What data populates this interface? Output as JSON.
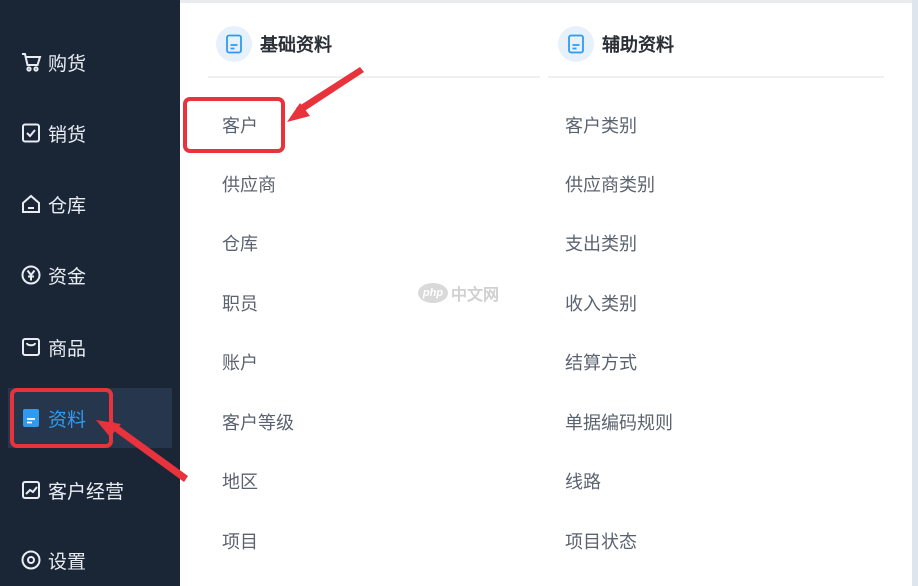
{
  "sidebar": {
    "items": [
      {
        "label": "购货",
        "icon": "cart-icon"
      },
      {
        "label": "销货",
        "icon": "sales-icon"
      },
      {
        "label": "仓库",
        "icon": "warehouse-icon"
      },
      {
        "label": "资金",
        "icon": "yuan-coin-icon"
      },
      {
        "label": "商品",
        "icon": "product-icon"
      },
      {
        "label": "资料",
        "icon": "document-icon",
        "active": true
      },
      {
        "label": "客户经营",
        "icon": "trend-chart-icon"
      },
      {
        "label": "设置",
        "icon": "settings-icon"
      }
    ]
  },
  "panel": {
    "columns": [
      {
        "title": "基础资料",
        "icon": "document-icon",
        "items": [
          "客户",
          "供应商",
          "仓库",
          "职员",
          "账户",
          "客户等级",
          "地区",
          "项目"
        ]
      },
      {
        "title": "辅助资料",
        "icon": "document-icon",
        "items": [
          "客户类别",
          "供应商类别",
          "支出类别",
          "收入类别",
          "结算方式",
          "单据编码规则",
          "线路",
          "项目状态"
        ]
      }
    ]
  },
  "watermark": {
    "logo": "php",
    "text": "中文网"
  },
  "colors": {
    "sidebar_bg": "#1a2636",
    "active_text": "#2e9bf0",
    "annotation_red": "#e8323c"
  }
}
